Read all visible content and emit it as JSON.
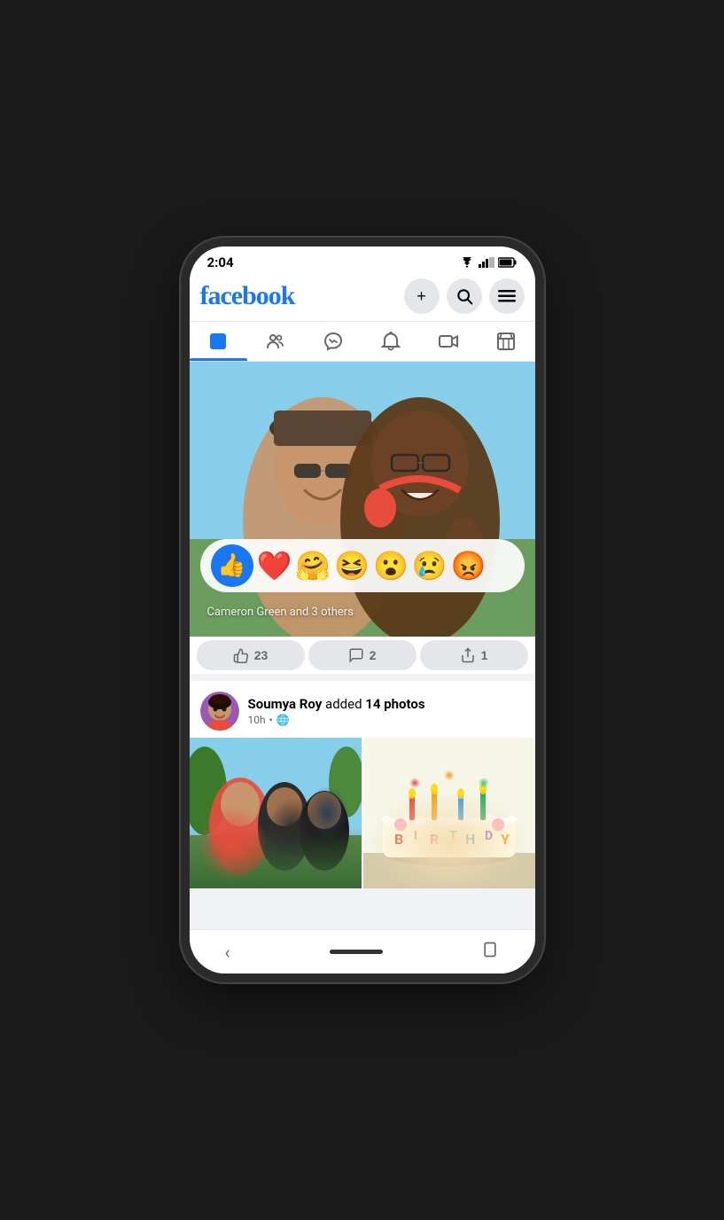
{
  "status": {
    "time": "2:04",
    "wifi": "wifi",
    "signal": "signal",
    "battery": "battery"
  },
  "header": {
    "logo": "facebook",
    "add_label": "+",
    "search_label": "🔍",
    "menu_label": "☰"
  },
  "nav": {
    "tabs": [
      {
        "id": "home",
        "label": "Home",
        "active": true
      },
      {
        "id": "friends",
        "label": "Friends",
        "active": false
      },
      {
        "id": "messenger",
        "label": "Messenger",
        "active": false
      },
      {
        "id": "notifications",
        "label": "Notifications",
        "active": false
      },
      {
        "id": "video",
        "label": "Video",
        "active": false
      },
      {
        "id": "marketplace",
        "label": "Marketplace",
        "active": false
      }
    ]
  },
  "post1": {
    "reactions": {
      "like": "👍",
      "love": "❤️",
      "care": "🤗",
      "haha": "😆",
      "wow": "😮",
      "sad": "😢",
      "angry": "😡"
    },
    "reactions_text": "Cameron Green and 3 others",
    "like_count": "23",
    "comment_count": "2",
    "share_count": "1",
    "like_label": "23",
    "comment_label": "2",
    "share_label": "1"
  },
  "post2": {
    "author_name": "Soumya Roy",
    "action": "added",
    "photo_count": "14 photos",
    "time": "10h",
    "privacy": "🌐"
  }
}
